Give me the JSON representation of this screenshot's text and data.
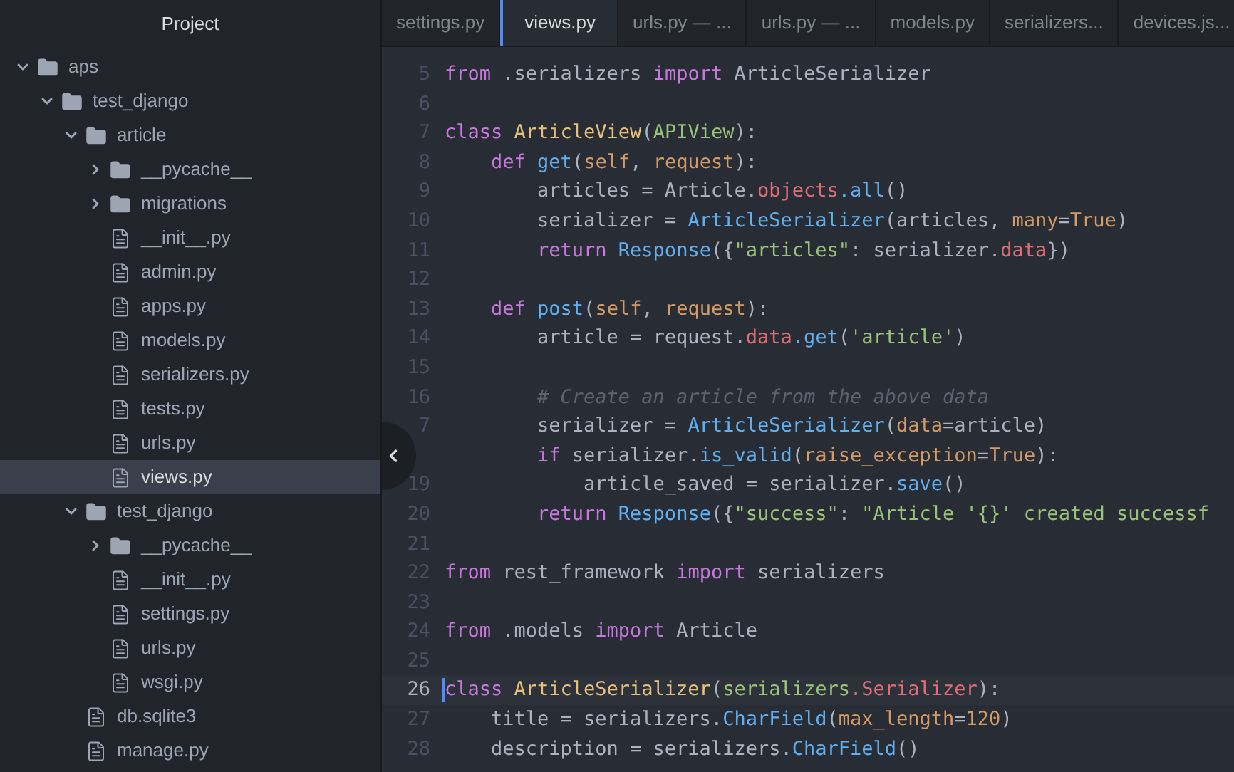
{
  "sidebar": {
    "title": "Project",
    "tree": [
      {
        "name": "aps",
        "kind": "folder",
        "expanded": true,
        "selected": false,
        "children": [
          {
            "name": "test_django",
            "kind": "folder",
            "expanded": true,
            "selected": false,
            "children": [
              {
                "name": "article",
                "kind": "folder",
                "expanded": true,
                "selected": false,
                "children": [
                  {
                    "name": "__pycache__",
                    "kind": "folder",
                    "expanded": false,
                    "selected": false
                  },
                  {
                    "name": "migrations",
                    "kind": "folder",
                    "expanded": false,
                    "selected": false
                  },
                  {
                    "name": "__init__.py",
                    "kind": "file",
                    "selected": false
                  },
                  {
                    "name": "admin.py",
                    "kind": "file",
                    "selected": false
                  },
                  {
                    "name": "apps.py",
                    "kind": "file",
                    "selected": false
                  },
                  {
                    "name": "models.py",
                    "kind": "file",
                    "selected": false
                  },
                  {
                    "name": "serializers.py",
                    "kind": "file",
                    "selected": false
                  },
                  {
                    "name": "tests.py",
                    "kind": "file",
                    "selected": false
                  },
                  {
                    "name": "urls.py",
                    "kind": "file",
                    "selected": false
                  },
                  {
                    "name": "views.py",
                    "kind": "file",
                    "selected": true
                  }
                ]
              },
              {
                "name": "test_django",
                "kind": "folder",
                "expanded": true,
                "selected": false,
                "children": [
                  {
                    "name": "__pycache__",
                    "kind": "folder",
                    "expanded": false,
                    "selected": false
                  },
                  {
                    "name": "__init__.py",
                    "kind": "file",
                    "selected": false
                  },
                  {
                    "name": "settings.py",
                    "kind": "file",
                    "selected": false
                  },
                  {
                    "name": "urls.py",
                    "kind": "file",
                    "selected": false
                  },
                  {
                    "name": "wsgi.py",
                    "kind": "file",
                    "selected": false
                  }
                ]
              },
              {
                "name": "db.sqlite3",
                "kind": "file",
                "selected": false
              },
              {
                "name": "manage.py",
                "kind": "file",
                "selected": false
              }
            ]
          }
        ]
      }
    ]
  },
  "tabs": [
    {
      "label": "settings.py",
      "selected": false
    },
    {
      "label": "views.py",
      "selected": true
    },
    {
      "label": "urls.py — ...",
      "selected": false
    },
    {
      "label": "urls.py — ...",
      "selected": false
    },
    {
      "label": "models.py",
      "selected": false
    },
    {
      "label": "serializers...",
      "selected": false
    },
    {
      "label": "devices.js...",
      "selected": false
    }
  ],
  "editor": {
    "lines": [
      {
        "number": "5",
        "current": false,
        "tokens": [
          {
            "kind": "keyword",
            "text": "from"
          },
          {
            "kind": "plain",
            "text": " .serializers "
          },
          {
            "kind": "keyword",
            "text": "import"
          },
          {
            "kind": "plain",
            "text": " ArticleSerializer"
          }
        ]
      },
      {
        "number": "6",
        "current": false
      },
      {
        "number": "7",
        "current": false,
        "tokens": [
          {
            "kind": "keyword",
            "text": "class"
          },
          {
            "kind": "class",
            "text": " ArticleView"
          },
          {
            "kind": "plain",
            "text": "("
          },
          {
            "kind": "string",
            "text": "APIView"
          },
          {
            "kind": "plain",
            "text": "):"
          }
        ]
      },
      {
        "number": "8",
        "current": false,
        "tokens": [
          {
            "kind": "keyword",
            "text": "    def"
          },
          {
            "kind": "func",
            "text": " get"
          },
          {
            "kind": "plain",
            "text": "("
          },
          {
            "kind": "param",
            "text": "self"
          },
          {
            "kind": "plain",
            "text": ","
          },
          {
            "kind": "param",
            "text": " request"
          },
          {
            "kind": "plain",
            "text": "):"
          }
        ]
      },
      {
        "number": "9",
        "current": false,
        "tokens": [
          {
            "kind": "plain",
            "text": "        articles = Article."
          },
          {
            "kind": "prop",
            "text": "objects"
          },
          {
            "kind": "func",
            "text": ".all"
          },
          {
            "kind": "plain",
            "text": "()"
          }
        ]
      },
      {
        "number": "10",
        "current": false,
        "tokens": [
          {
            "kind": "plain",
            "text": "        serializer = "
          },
          {
            "kind": "func",
            "text": "ArticleSerializer"
          },
          {
            "kind": "plain",
            "text": "(articles,"
          },
          {
            "kind": "param",
            "text": " many"
          },
          {
            "kind": "plain",
            "text": "="
          },
          {
            "kind": "param",
            "text": "True"
          },
          {
            "kind": "plain",
            "text": ")"
          }
        ]
      },
      {
        "number": "11",
        "current": false,
        "tokens": [
          {
            "kind": "keyword",
            "text": "        return"
          },
          {
            "kind": "func",
            "text": " Response"
          },
          {
            "kind": "plain",
            "text": "({"
          },
          {
            "kind": "string",
            "text": "\"articles\""
          },
          {
            "kind": "plain",
            "text": ": serializer."
          },
          {
            "kind": "prop",
            "text": "data"
          },
          {
            "kind": "plain",
            "text": "})"
          }
        ]
      },
      {
        "number": "12",
        "current": false
      },
      {
        "number": "13",
        "current": false,
        "tokens": [
          {
            "kind": "keyword",
            "text": "    def"
          },
          {
            "kind": "func",
            "text": " post"
          },
          {
            "kind": "plain",
            "text": "("
          },
          {
            "kind": "param",
            "text": "self"
          },
          {
            "kind": "plain",
            "text": ","
          },
          {
            "kind": "param",
            "text": " request"
          },
          {
            "kind": "plain",
            "text": "):"
          }
        ]
      },
      {
        "number": "14",
        "current": false,
        "tokens": [
          {
            "kind": "plain",
            "text": "        article = request."
          },
          {
            "kind": "prop",
            "text": "data"
          },
          {
            "kind": "func",
            "text": ".get"
          },
          {
            "kind": "plain",
            "text": "("
          },
          {
            "kind": "string",
            "text": "'article'"
          },
          {
            "kind": "plain",
            "text": ")"
          }
        ]
      },
      {
        "number": "15",
        "current": false
      },
      {
        "number": "16",
        "current": false,
        "tokens": [
          {
            "kind": "comment",
            "text": "        # Create an article from the above data"
          }
        ]
      },
      {
        "number": "7",
        "current": false,
        "tokens": [
          {
            "kind": "plain",
            "text": "        serializer = "
          },
          {
            "kind": "func",
            "text": "ArticleSerializer"
          },
          {
            "kind": "plain",
            "text": "("
          },
          {
            "kind": "param",
            "text": "data"
          },
          {
            "kind": "plain",
            "text": "=article)"
          }
        ]
      },
      {
        "current": false,
        "tokens": [
          {
            "kind": "keyword",
            "text": "        if"
          },
          {
            "kind": "plain",
            "text": " serializer."
          },
          {
            "kind": "func",
            "text": "is_valid"
          },
          {
            "kind": "plain",
            "text": "("
          },
          {
            "kind": "param",
            "text": "raise_exception"
          },
          {
            "kind": "plain",
            "text": "="
          },
          {
            "kind": "param",
            "text": "True"
          },
          {
            "kind": "plain",
            "text": "):"
          }
        ]
      },
      {
        "number": "19",
        "current": false,
        "tokens": [
          {
            "kind": "plain",
            "text": "            article_saved = serializer."
          },
          {
            "kind": "func",
            "text": "save"
          },
          {
            "kind": "plain",
            "text": "()"
          }
        ]
      },
      {
        "number": "20",
        "current": false,
        "tokens": [
          {
            "kind": "keyword",
            "text": "        return"
          },
          {
            "kind": "func",
            "text": " Response"
          },
          {
            "kind": "plain",
            "text": "({"
          },
          {
            "kind": "string",
            "text": "\"success\""
          },
          {
            "kind": "plain",
            "text": ":"
          },
          {
            "kind": "string",
            "text": " \"Article '{}' created successf"
          }
        ]
      },
      {
        "number": "21",
        "current": false
      },
      {
        "number": "22",
        "current": false,
        "tokens": [
          {
            "kind": "keyword",
            "text": "from"
          },
          {
            "kind": "plain",
            "text": " rest_framework "
          },
          {
            "kind": "keyword",
            "text": "import"
          },
          {
            "kind": "plain",
            "text": " serializers"
          }
        ]
      },
      {
        "number": "23",
        "current": false
      },
      {
        "number": "24",
        "current": false,
        "tokens": [
          {
            "kind": "keyword",
            "text": "from"
          },
          {
            "kind": "plain",
            "text": " .models "
          },
          {
            "kind": "keyword",
            "text": "import"
          },
          {
            "kind": "plain",
            "text": " Article"
          }
        ]
      },
      {
        "number": "25",
        "current": false
      },
      {
        "number": "26",
        "current": true,
        "tokens": [
          {
            "kind": "keyword",
            "text": "class"
          },
          {
            "kind": "class",
            "text": " ArticleSerializer"
          },
          {
            "kind": "plain",
            "text": "("
          },
          {
            "kind": "string",
            "text": "serializers"
          },
          {
            "kind": "prop",
            "text": ".Serializer"
          },
          {
            "kind": "plain",
            "text": "):"
          }
        ]
      },
      {
        "number": "27",
        "current": false,
        "tokens": [
          {
            "kind": "plain",
            "text": "    title = serializers."
          },
          {
            "kind": "func",
            "text": "CharField"
          },
          {
            "kind": "plain",
            "text": "("
          },
          {
            "kind": "param",
            "text": "max_length"
          },
          {
            "kind": "plain",
            "text": "="
          },
          {
            "kind": "param",
            "text": "120"
          },
          {
            "kind": "plain",
            "text": ")"
          }
        ]
      },
      {
        "number": "28",
        "current": false,
        "tokens": [
          {
            "kind": "plain",
            "text": "    description = serializers."
          },
          {
            "kind": "func",
            "text": "CharField"
          },
          {
            "kind": "plain",
            "text": "()"
          }
        ]
      }
    ]
  }
}
